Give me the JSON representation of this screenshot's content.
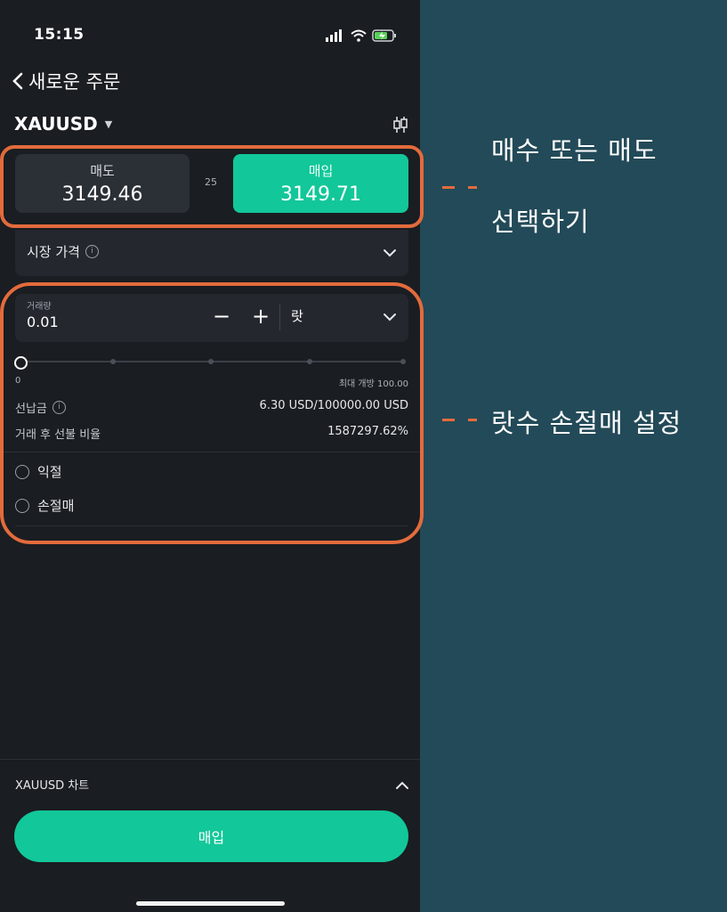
{
  "status_bar": {
    "time": "15:15"
  },
  "header": {
    "title": "새로운 주문"
  },
  "symbol": {
    "name": "XAUUSD"
  },
  "prices": {
    "sell_label": "매도",
    "sell_value": "3149.46",
    "spread": "25",
    "buy_label": "매입",
    "buy_value": "3149.71"
  },
  "order_type": {
    "label": "시장 가격"
  },
  "volume": {
    "label": "거래량",
    "value": "0.01",
    "unit": "랏",
    "minus": "−",
    "plus": "+"
  },
  "slider": {
    "min_label": "0",
    "max_label": "최대 개방 100.00",
    "position_fraction": 0
  },
  "margin": {
    "label": "선납금",
    "value": "6.30 USD/100000.00 USD"
  },
  "margin_ratio": {
    "label": "거래 후 선불 비율",
    "value": "1587297.62%"
  },
  "take_profit": {
    "label": "익절"
  },
  "stop_loss": {
    "label": "손절매"
  },
  "footer": {
    "chart_label": "XAUUSD 차트",
    "buy_button": "매입"
  },
  "annotations": {
    "callout_1_line1": "매수 또는 매도",
    "callout_1_line2": "선택하기",
    "callout_2": "랏수 손절매 설정",
    "highlight_color": "#e36b3c"
  },
  "colors": {
    "accent": "#12c799",
    "background": "#234a58",
    "panel": "#1a1d21"
  }
}
